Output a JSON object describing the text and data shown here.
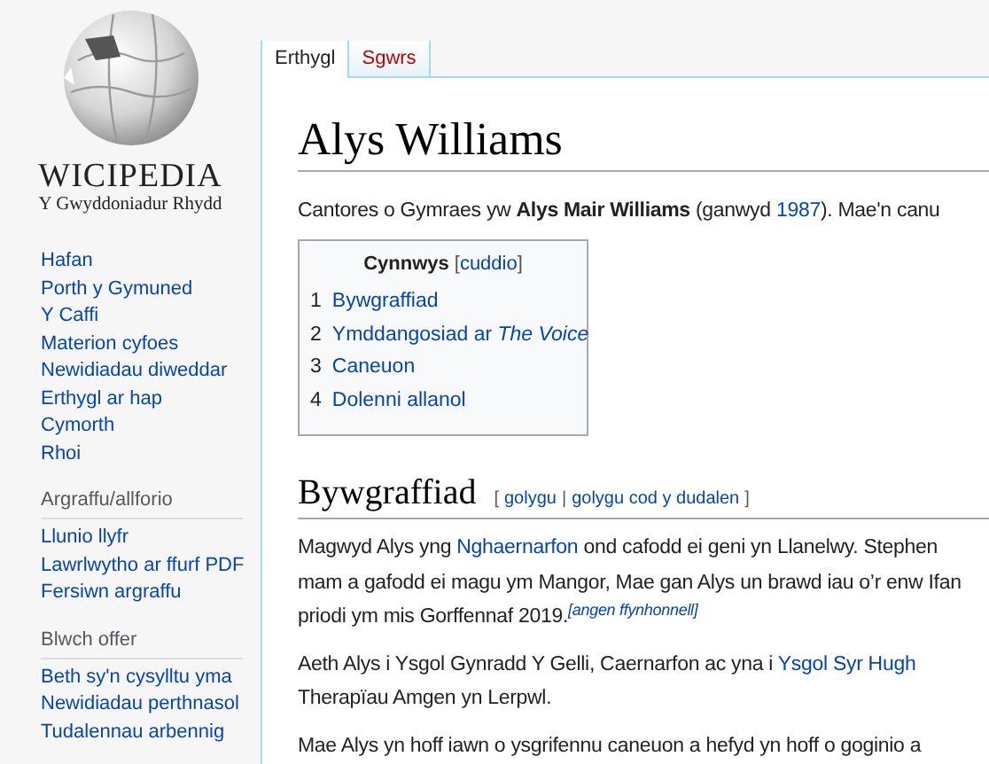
{
  "logo": {
    "wordmark": "WICIPEDIA",
    "tagline": "Y Gwyddoniadur Rhydd"
  },
  "sidebar": {
    "nav": [
      "Hafan",
      "Porth y Gymuned",
      "Y Caffi",
      "Materion cyfoes",
      "Newidiadau diweddar",
      "Erthygl ar hap",
      "Cymorth",
      "Rhoi"
    ],
    "sections": [
      {
        "heading": "Argraffu/allforio",
        "items": [
          "Llunio llyfr",
          "Lawrlwytho ar ffurf PDF",
          "Fersiwn argraffu"
        ]
      },
      {
        "heading": "Blwch offer",
        "items": [
          "Beth sy'n cysylltu yma",
          "Newidiadau perthnasol",
          "Tudalennau arbennig"
        ]
      }
    ]
  },
  "tabs": [
    {
      "label": "Erthygl",
      "selected": true,
      "missing": false
    },
    {
      "label": "Sgwrs",
      "selected": false,
      "missing": true
    }
  ],
  "title": "Alys Williams",
  "intro": [
    {
      "text": "Cantores o Gymraes yw **Alys Mair Williams** (ganwyd ",
      "link": false
    },
    {
      "text": "1987",
      "link": true
    },
    {
      "text": "). Mae'n canu",
      "link": false
    }
  ],
  "toc": {
    "title": "Cynnwys",
    "toggle_prefix": "[",
    "toggle": "cuddio",
    "toggle_suffix": "]",
    "items": [
      {
        "number": "1",
        "text": "Bywgraffiad"
      },
      {
        "number": "2",
        "text": "Ymddangosiad ar *The Voice*"
      },
      {
        "number": "3",
        "text": "Caneuon"
      },
      {
        "number": "4",
        "text": "Dolenni allanol"
      }
    ]
  },
  "section": {
    "heading": "Bywgraffiad",
    "edit_open": "[",
    "edit": "golygu",
    "edit_sep": "|",
    "edit_source": "golygu cod y dudalen",
    "edit_close": "]",
    "paragraphs": [
      [
        [
          {
            "text": "Magwyd Alys yng ",
            "link": false
          },
          {
            "text": "Nghaernarfon",
            "link": true
          },
          {
            "text": " ond cafodd ei geni yn Llanelwy. Stephen",
            "link": false
          }
        ],
        [
          {
            "text": "mam a gafodd ei magu ym Mangor, Mae gan Alys un brawd iau o’r enw Ifan",
            "link": false
          }
        ],
        [
          {
            "text": "priodi ym mis Gorffennaf 2019.",
            "link": false
          },
          {
            "text": "[angen ffynhonnell]",
            "link": true,
            "kind": "citation"
          }
        ]
      ],
      [
        [
          {
            "text": "Aeth Alys i Ysgol Gynradd Y Gelli, Caernarfon ac yna i ",
            "link": false
          },
          {
            "text": "Ysgol Syr Hugh",
            "link": true
          }
        ],
        [
          {
            "text": "Therapïau Amgen yn Lerpwl.",
            "link": false
          }
        ]
      ],
      [
        [
          {
            "text": "Mae Alys yn hoff iawn o ysgrifennu caneuon a hefyd yn hoff o goginio a",
            "link": false
          }
        ]
      ]
    ]
  }
}
